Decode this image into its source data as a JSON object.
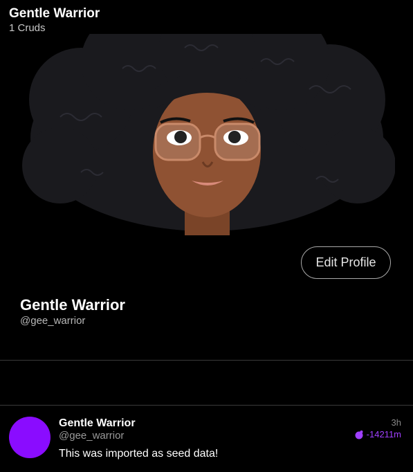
{
  "header": {
    "title": "Gentle Warrior",
    "count": "1 Cruds"
  },
  "profile": {
    "edit_button": "Edit Profile",
    "display_name": "Gentle Warrior",
    "handle": "@gee_warrior",
    "banner_icon": "cartoon-woman-banner-image"
  },
  "posts": [
    {
      "author": "Gentle Warrior",
      "handle": "@gee_warrior",
      "text": "This was imported as seed data!",
      "time": "3h",
      "score": "-14211m",
      "score_icon": "crud-orb-icon",
      "avatar_color": "#8a0cff"
    }
  ],
  "colors": {
    "accent": "#a040ff",
    "background": "#000000"
  }
}
